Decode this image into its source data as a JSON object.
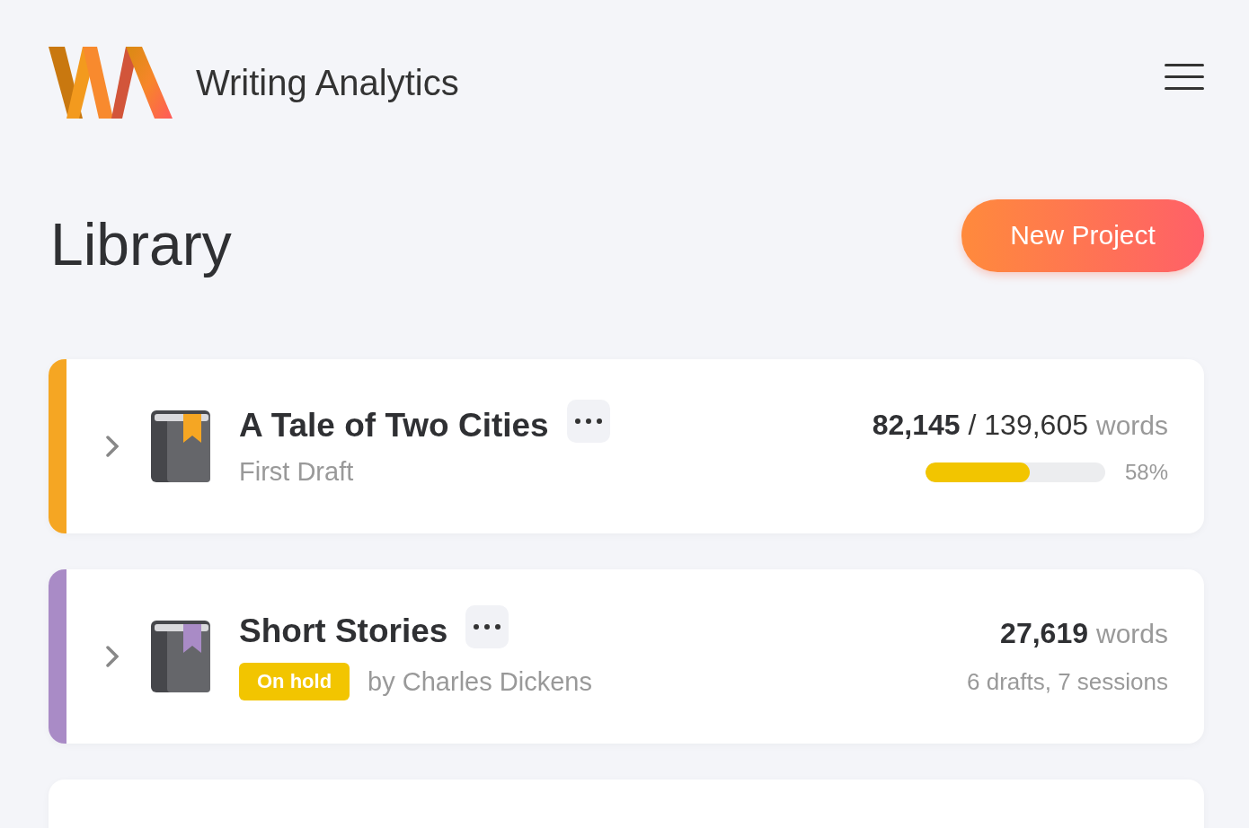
{
  "header": {
    "app_name": "Writing Analytics"
  },
  "page": {
    "title": "Library",
    "new_button": "New Project"
  },
  "projects": [
    {
      "kind": "progress",
      "color": "#f5a623",
      "expanded": false,
      "title": "A Tale of Two Cities",
      "subtitle": "First Draft",
      "words": "82,145",
      "target": "/ 139,605",
      "unit": "words",
      "level": 0.58,
      "percent": "58%"
    },
    {
      "kind": "stats",
      "color": "#a98bc6",
      "expanded": false,
      "title": "Short Stories",
      "badge": "On hold",
      "author": "by Charles Dickens",
      "words": "27,619",
      "unit": "words",
      "stats": "6 drafts, 7 sessions"
    },
    {
      "kind": "cut"
    }
  ]
}
